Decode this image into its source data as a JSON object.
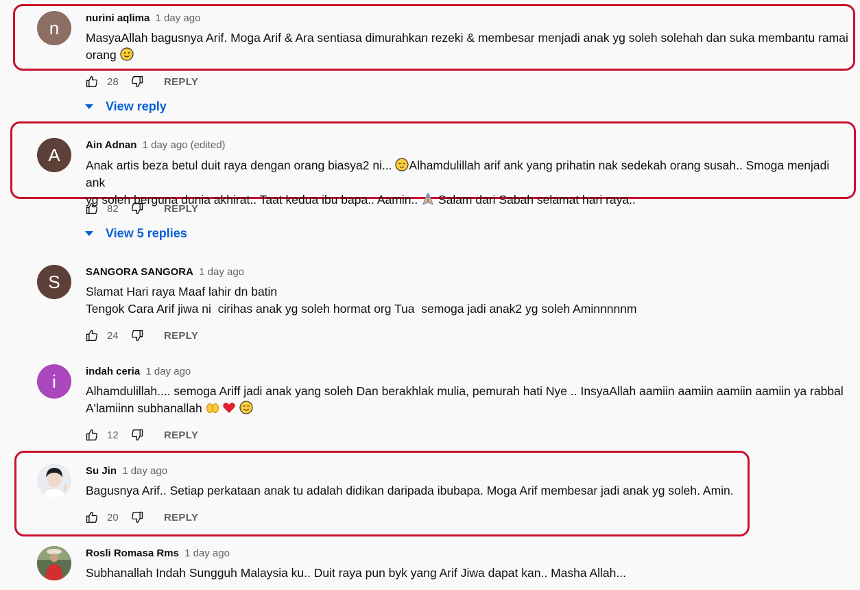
{
  "colors": {
    "highlight": "#c8102e",
    "link": "#065fd4",
    "text_secondary": "#606060"
  },
  "comments": [
    {
      "author": "nurini aqlima",
      "time": "1 day ago",
      "avatar_letter": "n",
      "avatar_color": "#8d6e63",
      "text_lines": [
        "MasyaAllah bagusnya Arif. Moga Arif & Ara sentiasa dimurahkan rezeki & membesar menjadi anak yg soleh solehah dan suka membantu ramai",
        "orang"
      ],
      "emoji_end": "slightly-smiling-face",
      "likes": "28",
      "reply_label": "REPLY",
      "view_replies": "View reply",
      "highlighted": true
    },
    {
      "author": "Ain Adnan",
      "time": "1 day ago (edited)",
      "avatar_letter": "A",
      "avatar_color": "#5d4037",
      "text_lines": [
        "Anak artis beza betul duit raya dengan orang biasya2 ni... ",
        "Alhamdulillah arif ank yang prihatin nak sedekah orang susah.. Smoga menjadi ank",
        "yg soleh berguna dunia akhirat.. Taat kedua ibu bapa.. Aamin.. ",
        " Salam dari Sabah selamat hari raya.."
      ],
      "likes": "82",
      "reply_label": "REPLY",
      "view_replies": "View 5 replies",
      "highlighted": true
    },
    {
      "author": "SANGORA SANGORA",
      "time": "1 day ago",
      "avatar_letter": "S",
      "avatar_color": "#5d4037",
      "text_lines": [
        "Slamat Hari raya Maaf lahir dn batin",
        "Tengok Cara Arif jiwa ni  cirihas anak yg soleh hormat org Tua  semoga jadi anak2 yg soleh Aminnnnnm"
      ],
      "likes": "24",
      "reply_label": "REPLY",
      "highlighted": false
    },
    {
      "author": "indah ceria",
      "time": "1 day ago",
      "avatar_letter": "i",
      "avatar_color": "#ab47bc",
      "text_lines": [
        "Alhamdulillah.... semoga Ariff jadi anak yang soleh Dan berakhlak mulia, pemurah hati Nye .. InsyaAllah aamiin aamiin aamiin aamiin ya rabbal",
        "A'lamiinn subhanallah "
      ],
      "likes": "12",
      "reply_label": "REPLY",
      "highlighted": false
    },
    {
      "author": "Su Jin",
      "time": "1 day ago",
      "avatar_letter": "",
      "text_lines": [
        "Bagusnya Arif.. Setiap perkataan anak tu adalah didikan daripada ibubapa. Moga Arif membesar jadi anak yg soleh. Amin."
      ],
      "likes": "20",
      "reply_label": "REPLY",
      "highlighted": true
    },
    {
      "author": "Rosli Romasa Rms",
      "time": "1 day ago",
      "avatar_letter": "",
      "text_lines": [
        "Subhanallah Indah Sungguh Malaysia ku.. Duit raya pun byk yang Arif Jiwa dapat kan.. Masha Allah..."
      ],
      "highlighted": false
    }
  ]
}
